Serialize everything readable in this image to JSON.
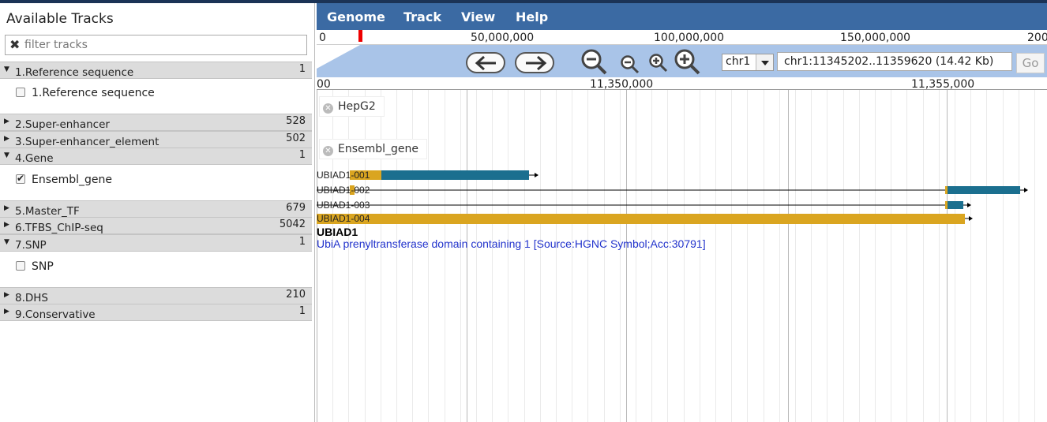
{
  "sidebar": {
    "title": "Available Tracks",
    "filter_placeholder": "filter tracks",
    "categories": [
      {
        "label": "1.Reference sequence",
        "count": "1",
        "expanded": true,
        "tracks": [
          {
            "label": "1.Reference sequence",
            "checked": false
          }
        ]
      },
      {
        "label": "2.Super-enhancer",
        "count": "528",
        "expanded": false
      },
      {
        "label": "3.Super-enhancer_element",
        "count": "502",
        "expanded": false
      },
      {
        "label": "4.Gene",
        "count": "1",
        "expanded": true,
        "tracks": [
          {
            "label": "Ensembl_gene",
            "checked": true
          }
        ]
      },
      {
        "label": "5.Master_TF",
        "count": "679",
        "expanded": false
      },
      {
        "label": "6.TFBS_ChIP-seq",
        "count": "5042",
        "expanded": false
      },
      {
        "label": "7.SNP",
        "count": "1",
        "expanded": true,
        "tracks": [
          {
            "label": "SNP",
            "checked": false
          }
        ]
      },
      {
        "label": "8.DHS",
        "count": "210",
        "expanded": false
      },
      {
        "label": "9.Conservative",
        "count": "1",
        "expanded": false
      }
    ]
  },
  "menu": {
    "items": [
      "Genome",
      "Track",
      "View",
      "Help"
    ]
  },
  "overview": {
    "ticks": [
      "0",
      "50,000,000",
      "100,000,000",
      "150,000,000",
      "200"
    ]
  },
  "navigation": {
    "chromosome": "chr1",
    "location": "chr1:11345202..11359620 (14.42 Kb)",
    "go_label": "Go"
  },
  "ruler": {
    "ticks": [
      "00",
      "11,350,000",
      "11,355,000"
    ]
  },
  "tracks": [
    {
      "label": "HepG2"
    },
    {
      "label": "Ensembl_gene"
    }
  ],
  "features": {
    "transcripts": [
      "UBIAD1-001",
      "UBIAD1-002",
      "UBIAD1-003",
      "UBIAD1-004"
    ],
    "gene_symbol": "UBIAD1",
    "gene_description": "UbiA prenyltransferase domain containing 1 [Source:HGNC Symbol;Acc:30791]"
  },
  "colors": {
    "menubar": "#3b6aa3",
    "utr": "#daa520",
    "cds": "#1b6f8f",
    "highlight_band": "#a9c4e8",
    "position_marker": "#ee0000",
    "description_text": "#2233cc"
  },
  "icons": [
    "filter-clear-icon",
    "expand-arrow-icon",
    "collapse-arrow-icon",
    "arrow-left-icon",
    "arrow-right-icon",
    "zoom-out-big-icon",
    "zoom-out-small-icon",
    "zoom-in-small-icon",
    "zoom-in-big-icon",
    "close-track-icon"
  ]
}
